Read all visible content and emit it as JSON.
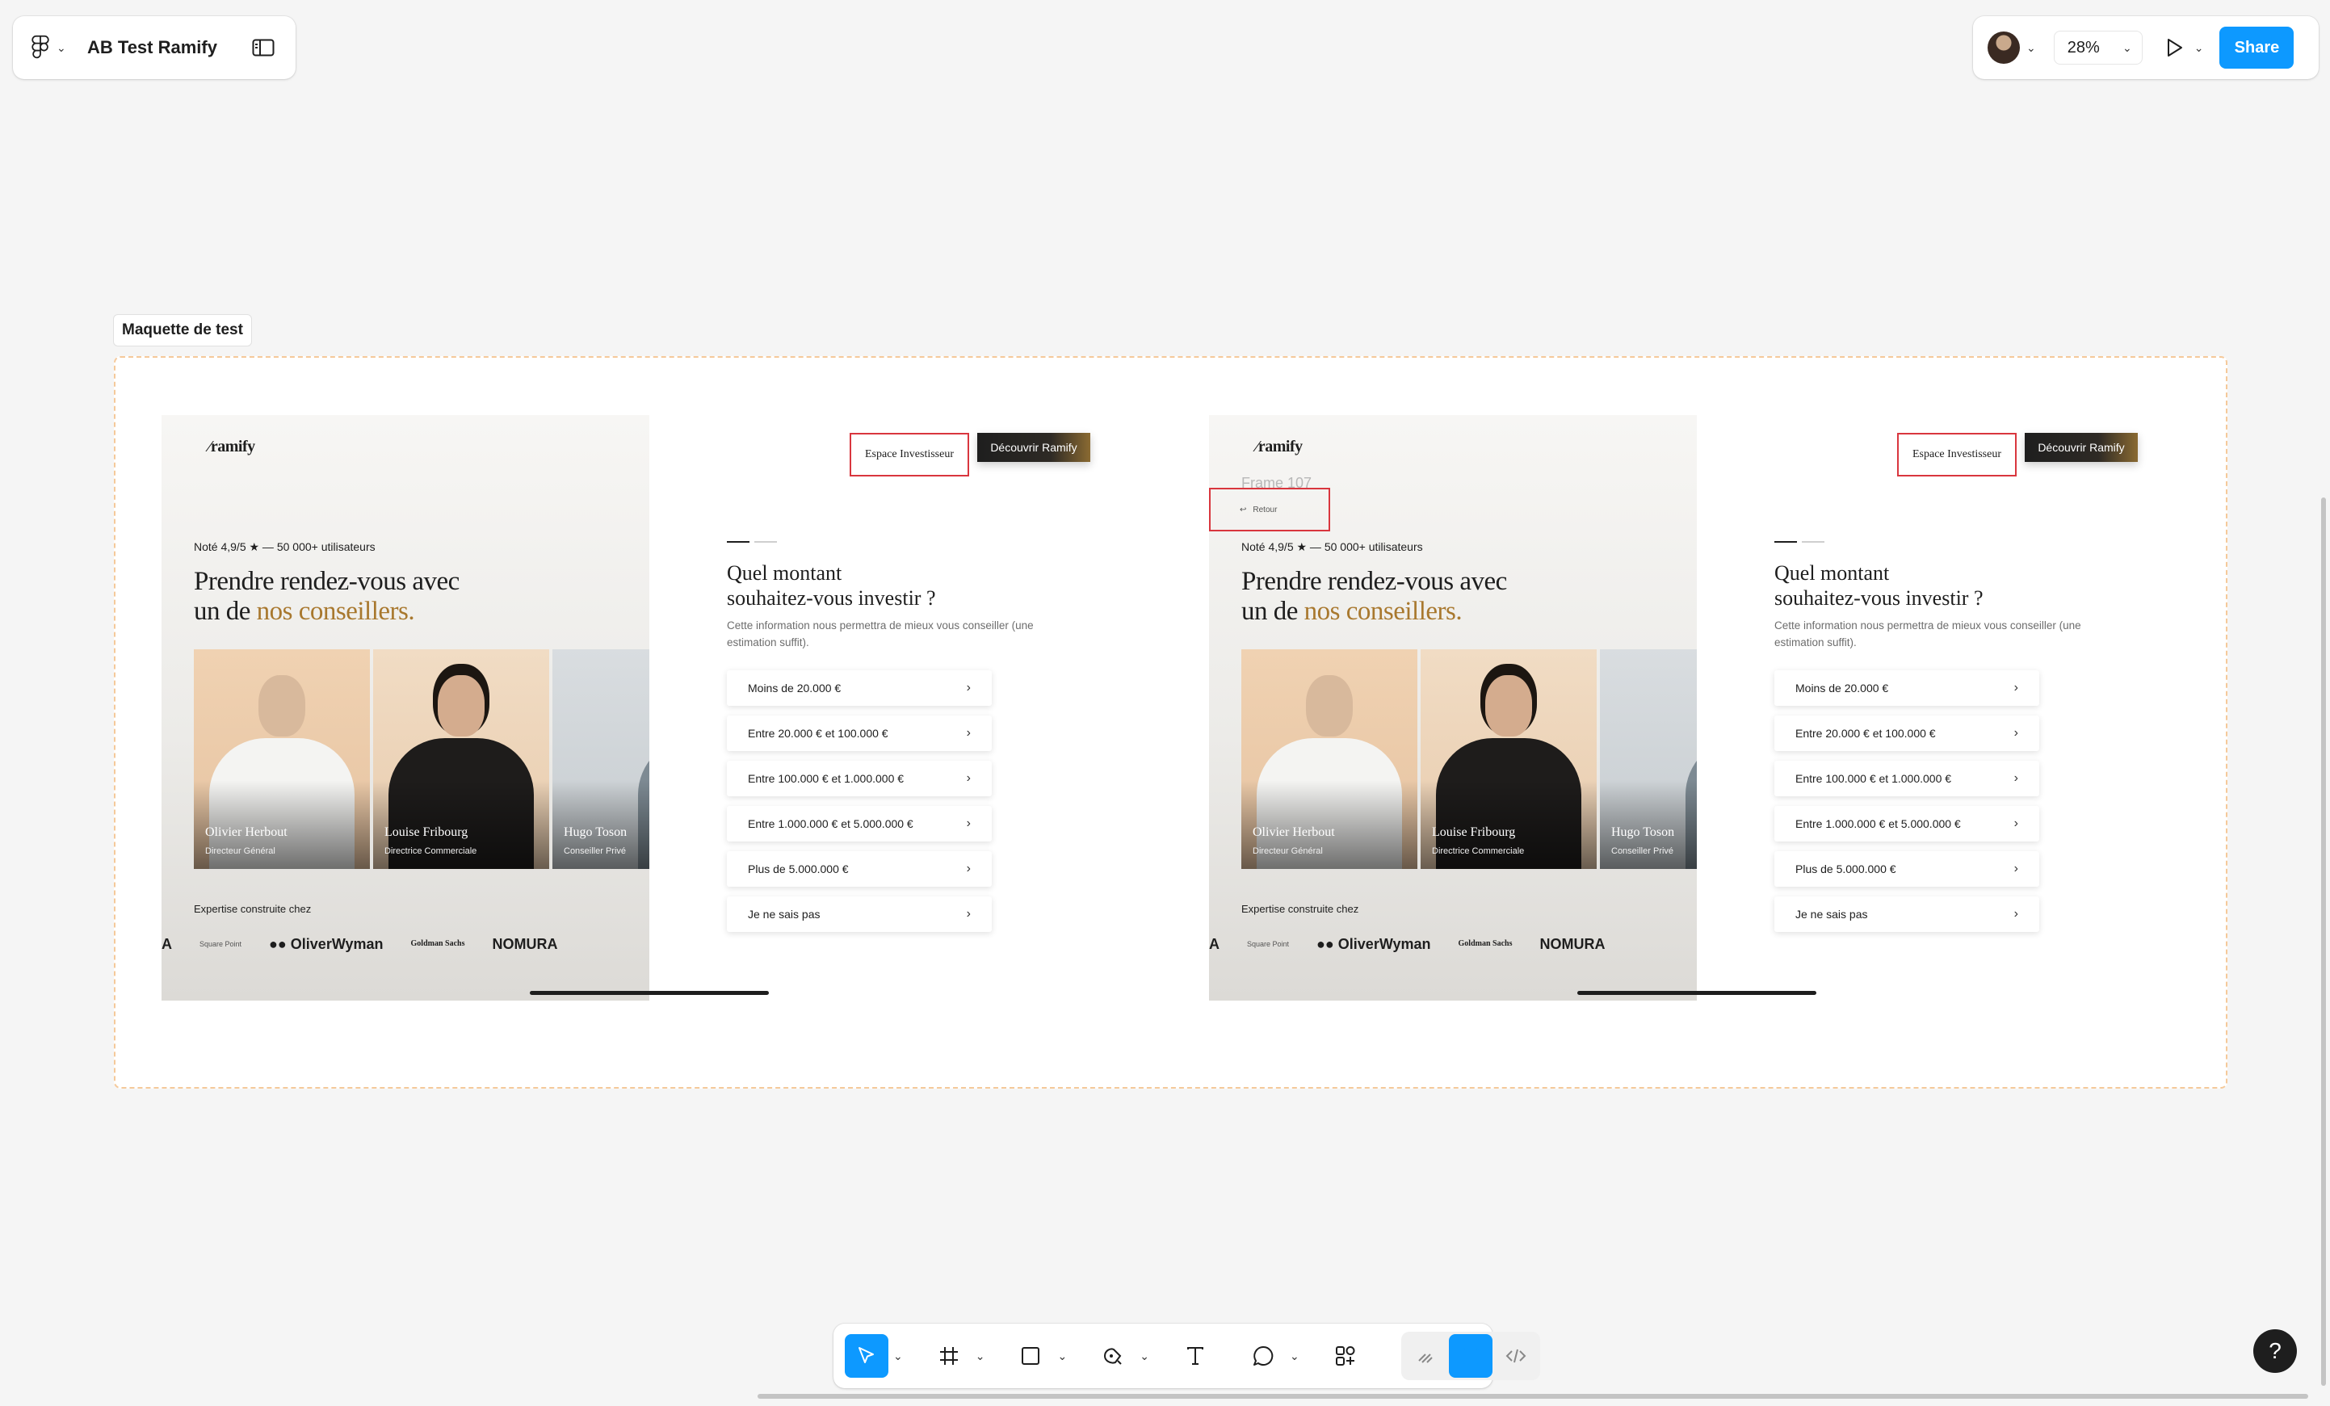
{
  "file": {
    "title": "AB Test Ramify"
  },
  "toolbar_right": {
    "zoom": "28%",
    "share": "Share"
  },
  "section": {
    "label": "Maquette de test"
  },
  "frames": [
    {
      "logo": "ramify",
      "rating": "Noté 4,9/5 ★ — 50 000+ utilisateurs",
      "headline_1": "Prendre rendez-vous avec",
      "headline_2": "un de ",
      "headline_accent": "nos conseillers.",
      "people": [
        {
          "name": "Olivier Herbout",
          "role": "Directeur Général"
        },
        {
          "name": "Louise Fribourg",
          "role": "Directrice Commerciale"
        },
        {
          "name": "Hugo Toson",
          "role": "Conseiller Privé"
        }
      ],
      "expertise": "Expertise construite chez",
      "partners": [
        "A",
        "Square Point",
        "OliverWyman",
        "Goldman Sachs",
        "NOMURA"
      ],
      "btn_investor": "Espace Investisseur",
      "btn_discover": "Découvrir Ramify",
      "question_1": "Quel montant",
      "question_2": "souhaitez-vous investir ?",
      "helper": "Cette information nous permettra de mieux vous conseiller (une estimation suffit).",
      "options": [
        "Moins de 20.000 €",
        "Entre 20.000 € et 100.000 €",
        "Entre 100.000 € et 1.000.000 €",
        "Entre 1.000.000 € et 5.000.000 €",
        "Plus de 5.000.000 €",
        "Je ne sais pas"
      ]
    },
    {
      "frame_label": "Frame 107",
      "back": "Retour",
      "logo": "ramify",
      "rating": "Noté 4,9/5 ★ — 50 000+ utilisateurs",
      "headline_1": "Prendre rendez-vous avec",
      "headline_2": "un de ",
      "headline_accent": "nos conseillers.",
      "people": [
        {
          "name": "Olivier Herbout",
          "role": "Directeur Général"
        },
        {
          "name": "Louise Fribourg",
          "role": "Directrice Commerciale"
        },
        {
          "name": "Hugo Toson",
          "role": "Conseiller Privé"
        }
      ],
      "expertise": "Expertise construite chez",
      "partners": [
        "A",
        "Square Point",
        "OliverWyman",
        "Goldman Sachs",
        "NOMURA"
      ],
      "btn_investor": "Espace Investisseur",
      "btn_discover": "Découvrir Ramify",
      "question_1": "Quel montant",
      "question_2": "souhaitez-vous investir ?",
      "helper": "Cette information nous permettra de mieux vous conseiller (une estimation suffit).",
      "options": [
        "Moins de 20.000 €",
        "Entre 20.000 € et 100.000 €",
        "Entre 100.000 € et 1.000.000 €",
        "Entre 1.000.000 € et 5.000.000 €",
        "Plus de 5.000.000 €",
        "Je ne sais pas"
      ]
    }
  ],
  "help": "?",
  "colors": {
    "accent": "#0d99ff",
    "gold": "#a8782e",
    "red_outline": "#d9363e"
  }
}
